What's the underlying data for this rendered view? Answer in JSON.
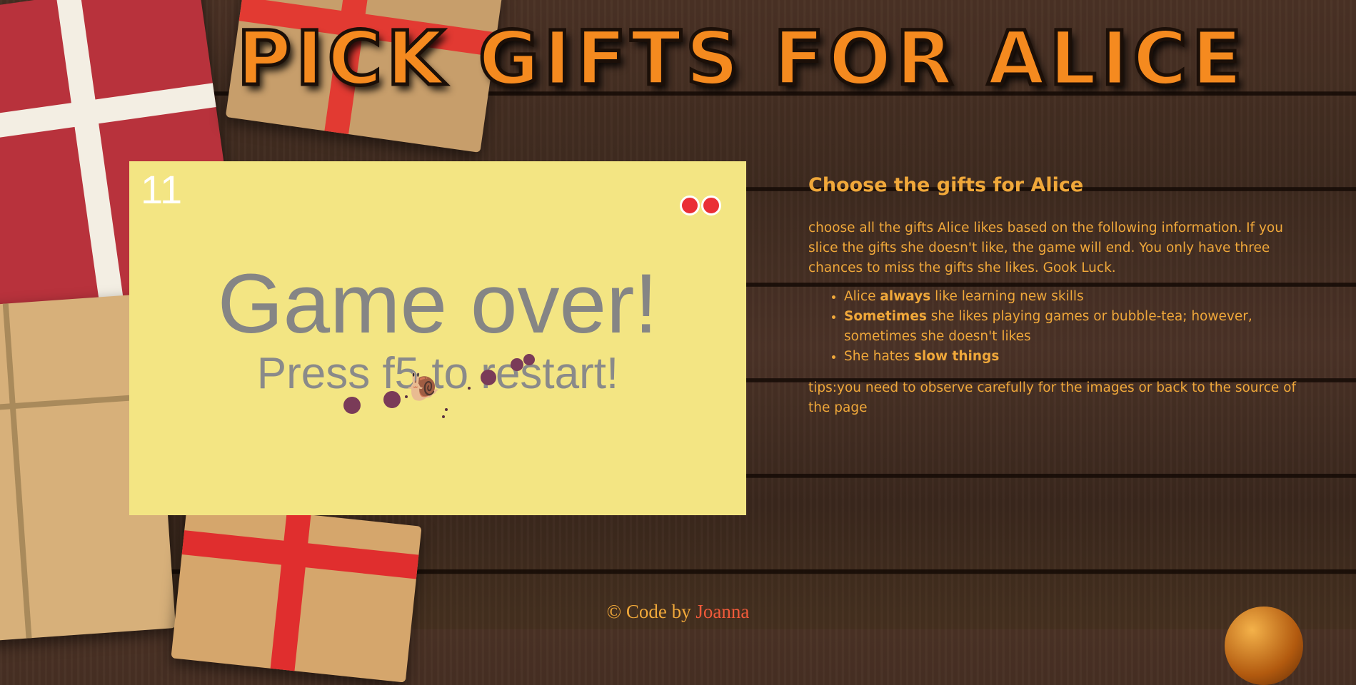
{
  "title": "PICK GIFTS FOR ALICE",
  "game": {
    "score": "11",
    "lives_remaining": 2,
    "game_over_text": "Game over!",
    "restart_text": "Press f5 to restart!",
    "snail_icon": "snail-icon",
    "colors": {
      "board": "#f3e583",
      "life": "#ea2e36",
      "splat": "#7a3b58"
    }
  },
  "info": {
    "heading": "Choose the gifts for Alice",
    "intro": "choose all the gifts Alice likes based on the following information. If you slice the gifts she doesn't like, the game will end. You only have three chances to miss the gifts she likes. Gook Luck.",
    "rules": [
      {
        "before": "Alice ",
        "bold": "always",
        "after": " like learning new skills"
      },
      {
        "before": "",
        "bold": "Sometimes",
        "after": " she likes playing games or bubble-tea; however, sometimes she doesn't likes"
      },
      {
        "before": "She hates ",
        "bold": "slow things",
        "after": ""
      }
    ],
    "tips": "tips:you need to observe carefully for the images or back to the source of the page"
  },
  "footer": {
    "prefix": "© Code by",
    "author": "Joanna"
  },
  "colors": {
    "accent": "#f0a83a",
    "title": "#f58a1f",
    "author": "#f05a3a"
  }
}
